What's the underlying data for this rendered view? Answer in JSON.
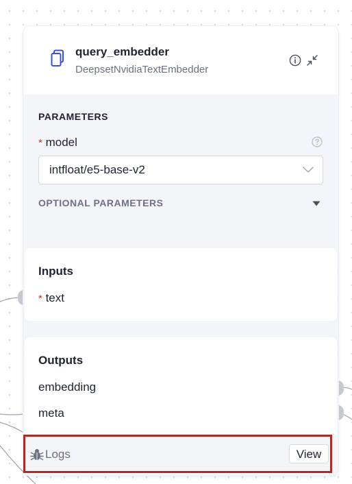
{
  "node": {
    "title": "query_embedder",
    "subtitle": "DeepsetNvidiaTextEmbedder",
    "icons": {
      "component": "document-copy-icon",
      "info": "info-icon",
      "collapse": "collapse-arrows-icon"
    }
  },
  "parameters": {
    "section_label": "PARAMETERS",
    "required_marker": "*",
    "model_label": "model",
    "model_value": "intfloat/e5-base-v2",
    "optional_label": "OPTIONAL PARAMETERS"
  },
  "inputs": {
    "title": "Inputs",
    "required_marker": "*",
    "items": [
      "text"
    ]
  },
  "outputs": {
    "title": "Outputs",
    "items": [
      "embedding",
      "meta"
    ]
  },
  "logs": {
    "label": "Logs",
    "view_label": "View"
  },
  "colors": {
    "accent": "#3b4fd8",
    "required": "#c0392b",
    "highlight_border": "#a72d26",
    "panel_bg": "#f4f5f9"
  }
}
